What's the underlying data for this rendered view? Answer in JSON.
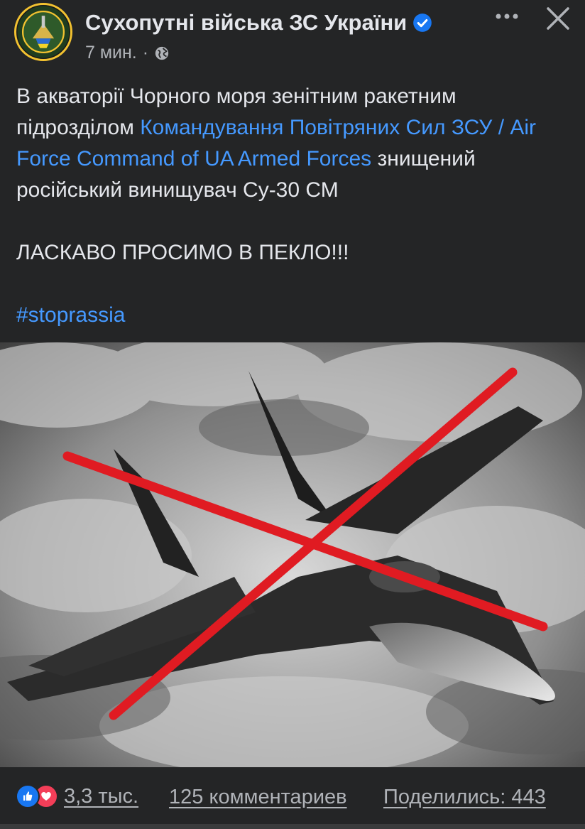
{
  "post": {
    "page_name": "Сухопутні війська ЗС України",
    "time": "7 мин.",
    "separator": "·",
    "audience_icon": "globe-icon",
    "verified_icon": "verified-badge-icon",
    "text": {
      "line1": "В акваторії Чорного моря зенітним ракетним підрозділом ",
      "mention": "Командування Повітряних Сил ЗСУ / Air Force Command of UA Armed Forces",
      "line2": " знищений російський винищувач Су-30 СМ",
      "shout": "ЛАСКАВО ПРОСИМО В ПЕКЛО!!!",
      "hashtag": "#stoprassia"
    },
    "image": {
      "subject": "fighter-jet-crossed-out",
      "accent_color": "#e01b22"
    }
  },
  "footer": {
    "reactions_count": "3,3 тыс.",
    "comments": "125 комментариев",
    "shares": "Поделились: 443",
    "like_color": "#1877f2",
    "love_color": "#f33e58",
    "link_color": "#4599ff"
  }
}
